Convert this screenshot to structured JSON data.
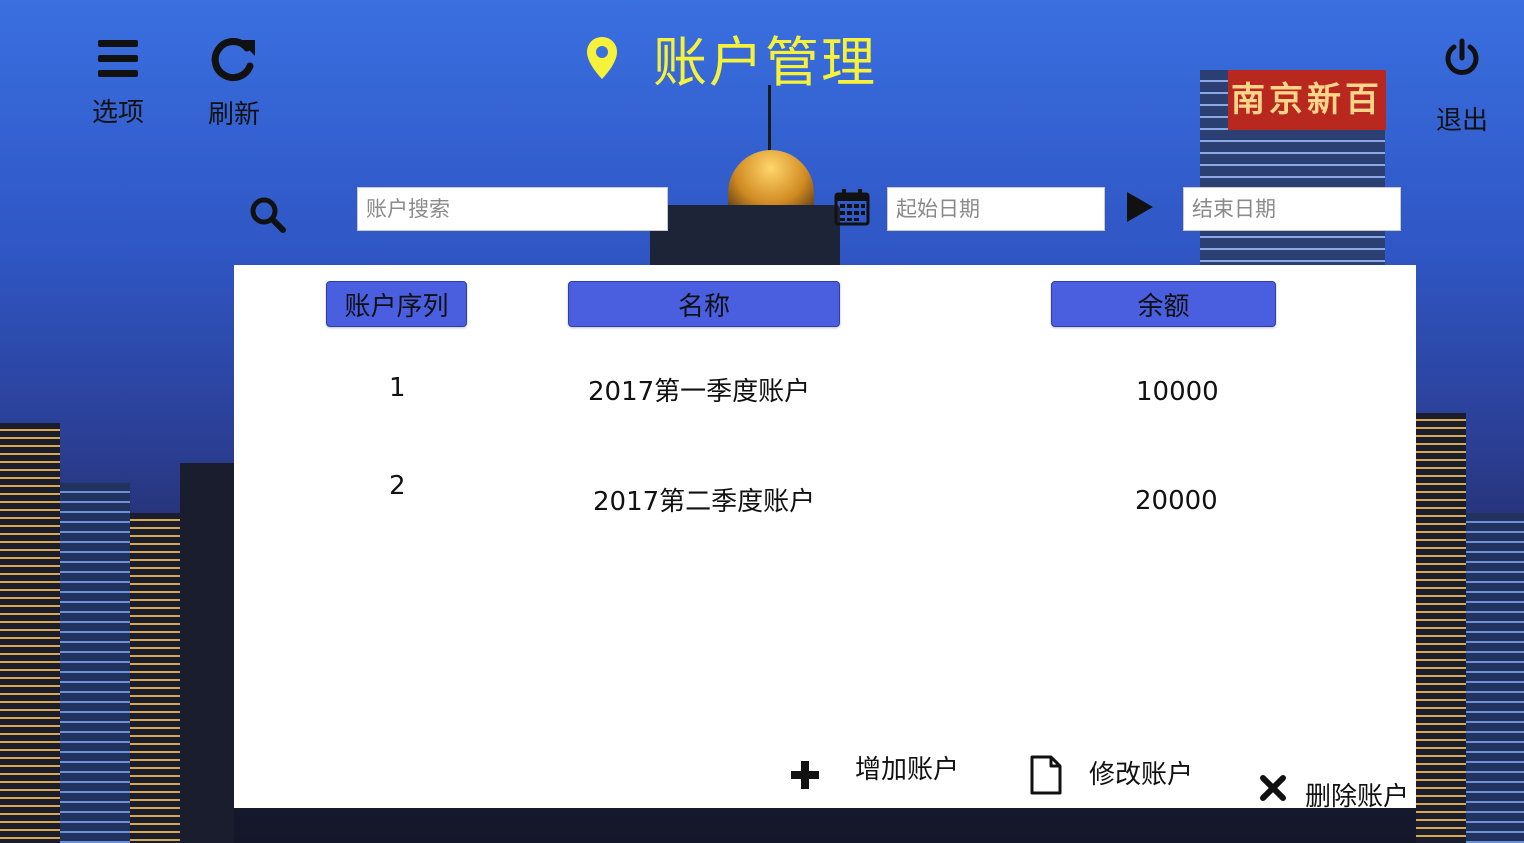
{
  "header": {
    "title": "账户管理",
    "menu_label": "选项",
    "refresh_label": "刷新",
    "logout_label": "退出"
  },
  "filters": {
    "search_placeholder": "账户搜索",
    "start_date_placeholder": "起始日期",
    "end_date_placeholder": "结束日期"
  },
  "table": {
    "columns": [
      "账户序列",
      "名称",
      "余额"
    ],
    "rows": [
      {
        "id": "1",
        "name": "2017第一季度账户",
        "balance": "10000"
      },
      {
        "id": "2",
        "name": "2017第二季度账户",
        "balance": "20000"
      }
    ]
  },
  "actions": {
    "add_label": "增加账户",
    "edit_label": "修改账户",
    "delete_label": "删除账户"
  },
  "background": {
    "neon_sign": "南京新百"
  },
  "colors": {
    "title": "#f6f23a",
    "header_button": "#4a5ee0",
    "sky_top": "#3a6fe0"
  },
  "icons": [
    "menu-icon",
    "refresh-icon",
    "location-icon",
    "power-icon",
    "search-icon",
    "calendar-icon",
    "play-arrow-icon",
    "plus-icon",
    "document-icon",
    "close-icon"
  ]
}
